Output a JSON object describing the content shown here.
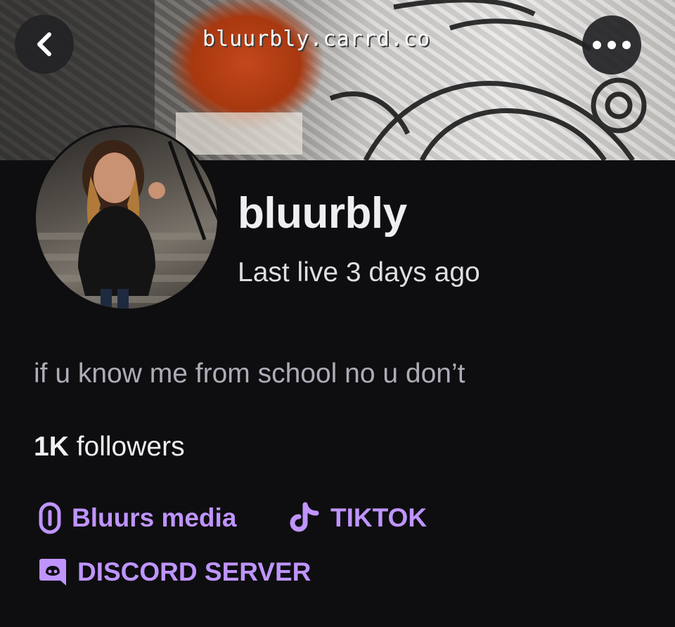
{
  "header": {
    "banner_url_text": "bluurbly.carrd.co",
    "back_icon": "chevron-left-icon",
    "more_icon": "more-horizontal-icon"
  },
  "profile": {
    "username": "bluurbly",
    "last_live": "Last live 3 days ago",
    "bio": "if u know me from school no u don’t",
    "followers_count": "1K",
    "followers_label": " followers"
  },
  "links": [
    {
      "label": "Bluurs media",
      "icon": "link-chain-icon"
    },
    {
      "label": "TIKTOK",
      "icon": "tiktok-icon"
    },
    {
      "label": "DISCORD SERVER",
      "icon": "discord-icon"
    }
  ],
  "colors": {
    "background": "#0e0e10",
    "accent_link": "#bf94ff",
    "button_bg": "#232326"
  }
}
